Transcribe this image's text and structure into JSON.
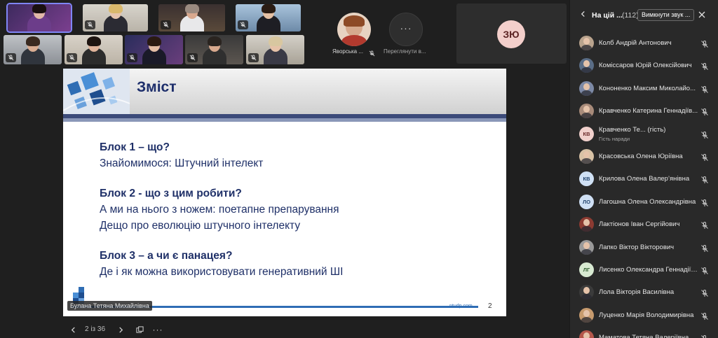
{
  "video_tiles": [
    {
      "kind": "self"
    },
    {
      "kind": "video"
    },
    {
      "kind": "video"
    },
    {
      "kind": "video"
    },
    {
      "kind": "video"
    },
    {
      "kind": "video"
    },
    {
      "kind": "video"
    },
    {
      "kind": "video"
    },
    {
      "kind": "video"
    }
  ],
  "round_participants": [
    {
      "label": "Яворська ..."
    },
    {
      "label": "Переглянути в..."
    }
  ],
  "large_tile": {
    "initials": "ЗЮ"
  },
  "slide": {
    "title": "Зміст",
    "blocks": [
      {
        "heading": "Блок 1 – що?",
        "lines": [
          "Знайомимося: Штучний інтелект"
        ]
      },
      {
        "heading": "Блок 2 - що з цим робити?",
        "lines": [
          "А ми на нього з ножем: поетапне препарування",
          "Дещо про еволюцію штучного інтелекту"
        ]
      },
      {
        "heading": "Блок 3 – а чи є панацея?",
        "lines": [
          "Де і як можна використовувати генеративний ШІ"
        ]
      }
    ],
    "site": "ntudp.com",
    "page_number": "2",
    "presenter_name": "Булана Тетяна Михайлівна"
  },
  "nav": {
    "page_counter": "2 із 36"
  },
  "panel": {
    "title": "На цій ...",
    "count": "(112)",
    "mute_all_label": "Вимкнути звук ...",
    "participants": [
      {
        "name": "Колб Андрій Антонович",
        "avatar": "photo",
        "color": "#b9a38d"
      },
      {
        "name": "Комісcаров Юрій Олексійович",
        "avatar": "photo",
        "color": "#5a6d86"
      },
      {
        "name": "Кононенко Максим Миколайо...",
        "avatar": "photo",
        "color": "#7d8aa6"
      },
      {
        "name": "Кравченко Катерина Геннадіїв...",
        "avatar": "photo",
        "color": "#a88b7a"
      },
      {
        "name": "Кравченко Те... (гість)",
        "sub": "Гість наради",
        "avatar": "initials",
        "initials": "КВ",
        "tone": "pink"
      },
      {
        "name": "Красовська Олена Юріївна",
        "avatar": "photo",
        "color": "#d8c2a6"
      },
      {
        "name": "Крилова Олена Валер’янівна",
        "avatar": "initials",
        "initials": "КВ",
        "tone": "blue"
      },
      {
        "name": "Лагошна Олена Олександрівна",
        "avatar": "initials",
        "initials": "ЛО",
        "tone": "blue"
      },
      {
        "name": "Лактіонов Іван Сергійович",
        "avatar": "photo",
        "color": "#8c3b32"
      },
      {
        "name": "Лапко Віктор Вікторович",
        "avatar": "photo",
        "color": "#9a9a9a"
      },
      {
        "name": "Лисенко Олександра Геннадіїв...",
        "avatar": "initials",
        "initials": "ЛГ",
        "tone": "green"
      },
      {
        "name": "Лола Вікторія Василівна",
        "avatar": "photo",
        "color": "#3b3b3b"
      },
      {
        "name": "Луценко Марія Володимирівна",
        "avatar": "photo",
        "color": "#c79b6e"
      },
      {
        "name": "Маматова Тетяна Валеріївна",
        "avatar": "photo",
        "color": "#b4574b"
      }
    ]
  }
}
